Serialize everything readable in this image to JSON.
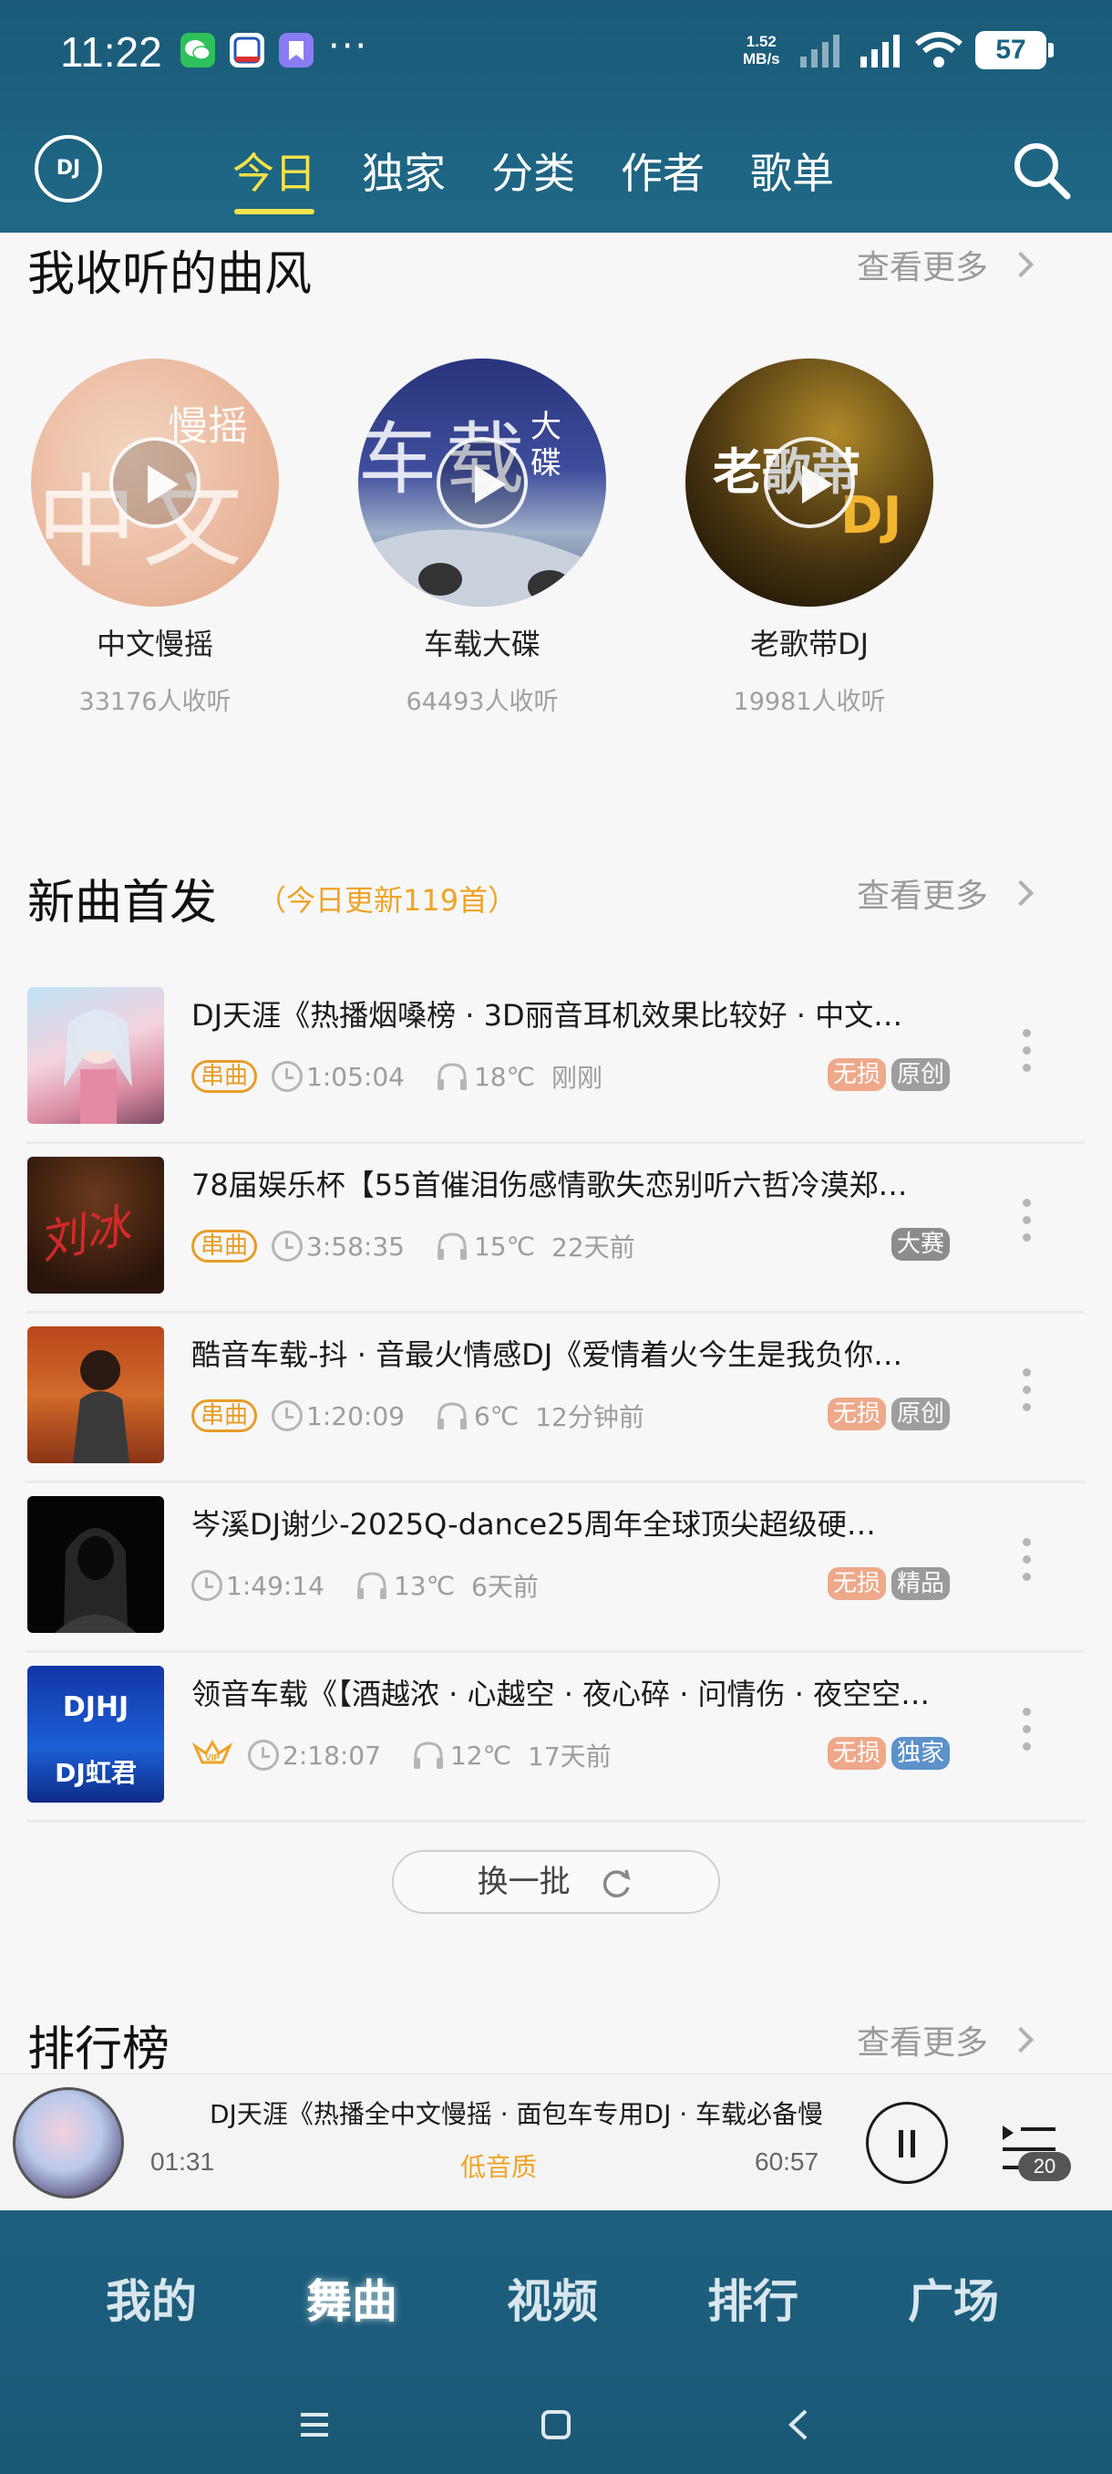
{
  "status": {
    "time": "11:22",
    "more": "···",
    "speed_value": "1.52",
    "speed_unit": "MB/s",
    "battery": "57"
  },
  "header": {
    "logo_text": "DJ",
    "tabs": [
      {
        "label": "今日",
        "active": true
      },
      {
        "label": "独家",
        "active": false
      },
      {
        "label": "分类",
        "active": false
      },
      {
        "label": "作者",
        "active": false
      },
      {
        "label": "歌单",
        "active": false
      }
    ]
  },
  "genres_section": {
    "title": "我收听的曲风",
    "more": "查看更多",
    "items": [
      {
        "name": "中文慢摇",
        "count": "33176人收听",
        "art_text": "慢摇",
        "art_big": "中文"
      },
      {
        "name": "车载大碟",
        "count": "64493人收听",
        "art_text": "大碟",
        "art_big": "车载"
      },
      {
        "name": "老歌带DJ",
        "count": "19981人收听",
        "art_text": "老歌带",
        "art_big": "DJ"
      }
    ]
  },
  "new_section": {
    "title": "新曲首发",
    "subtitle": "（今日更新119首）",
    "more": "查看更多",
    "refresh": "换一批",
    "songs": [
      {
        "title": "DJ天涯《热播烟嗓榜 · 3D丽音耳机效果比较好 · 中文…",
        "badge": "串曲",
        "duration": "1:05:04",
        "temp": "18℃",
        "time": "刚刚",
        "tags": [
          {
            "label": "无损",
            "kind": "lossless"
          },
          {
            "label": "原创",
            "kind": "original"
          }
        ]
      },
      {
        "title": "78届娱乐杯【55首催泪伤感情歌失恋别听六哲冷漠郑…",
        "badge": "串曲",
        "duration": "3:58:35",
        "temp": "15℃",
        "time": "22天前",
        "tags": [
          {
            "label": "大赛",
            "kind": "contest"
          }
        ]
      },
      {
        "title": "酷音车载-抖 · 音最火情感DJ《爱情着火今生是我负你…",
        "badge": "串曲",
        "duration": "1:20:09",
        "temp": "6℃",
        "time": "12分钟前",
        "tags": [
          {
            "label": "无损",
            "kind": "lossless"
          },
          {
            "label": "原创",
            "kind": "original"
          }
        ]
      },
      {
        "title": "岑溪DJ谢少-2025Q-dance25周年全球顶尖超级硬…",
        "badge": "",
        "duration": "1:49:14",
        "temp": "13℃",
        "time": "6天前",
        "tags": [
          {
            "label": "无损",
            "kind": "lossless"
          },
          {
            "label": "精品",
            "kind": "premium"
          }
        ]
      },
      {
        "title": "领音车载《【酒越浓 · 心越空 · 夜心碎 · 问情伤 · 夜空空…",
        "badge": "VIP",
        "duration": "2:18:07",
        "temp": "12℃",
        "time": "17天前",
        "tags": [
          {
            "label": "无损",
            "kind": "lossless"
          },
          {
            "label": "独家",
            "kind": "exclusive"
          }
        ]
      }
    ],
    "thumb_labels": {
      "song2": "刘冰",
      "song5_top": "DJHJ",
      "song5_bottom": "DJ虹君"
    }
  },
  "rank_section": {
    "title": "排行榜",
    "more": "查看更多"
  },
  "player": {
    "title": "DJ天涯《热播全中文慢摇 · 面包车专用DJ · 车载必备慢",
    "elapsed": "01:31",
    "quality": "低音质",
    "total": "60:57",
    "queue_count": "20"
  },
  "bottom_nav": [
    {
      "label": "我的",
      "active": false
    },
    {
      "label": "舞曲",
      "active": true
    },
    {
      "label": "视频",
      "active": false
    },
    {
      "label": "排行",
      "active": false
    },
    {
      "label": "广场",
      "active": false
    }
  ]
}
